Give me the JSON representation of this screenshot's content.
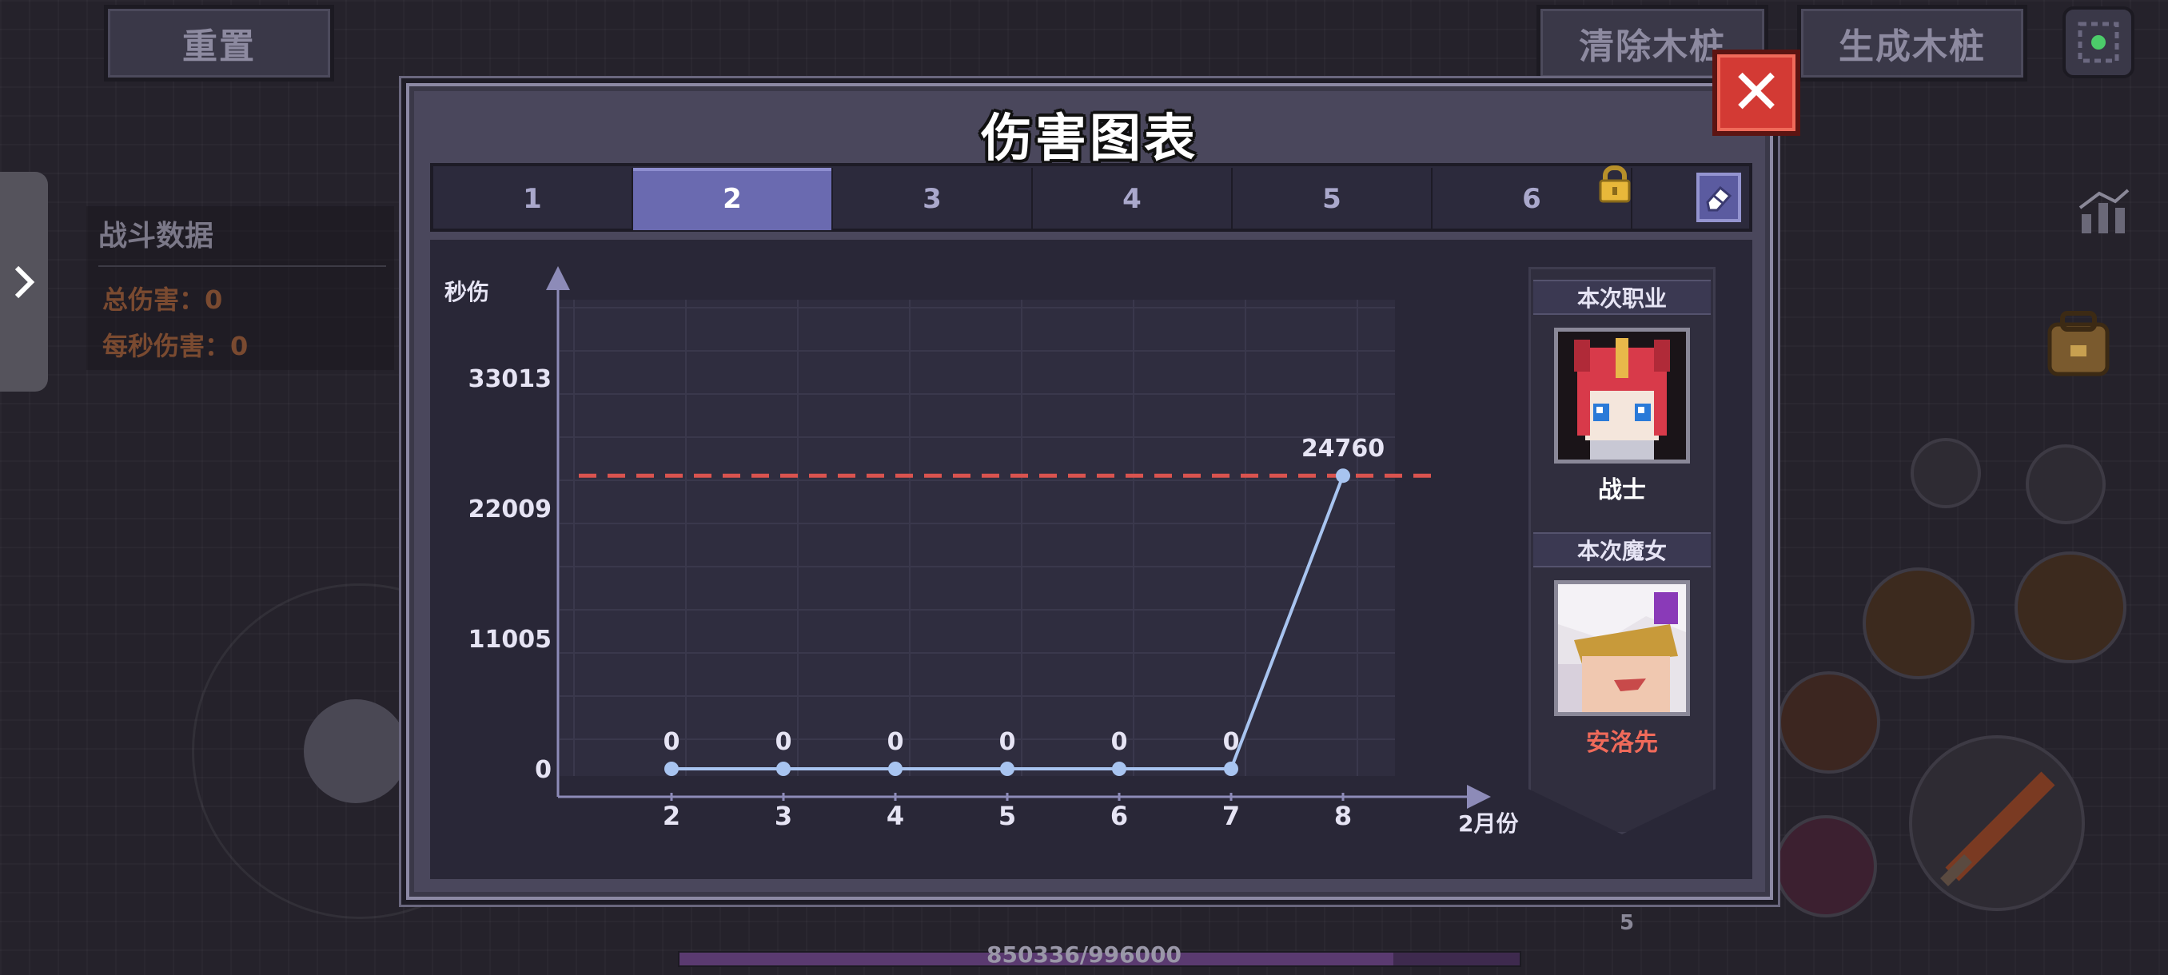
{
  "hud": {
    "reset_label": "重置",
    "clear_dummy_label": "清除木桩",
    "spawn_dummy_label": "生成木桩",
    "hp_text": "850336/996000",
    "skill_count": "5"
  },
  "stats_panel": {
    "title": "战斗数据",
    "total_damage": "总伤害：0",
    "dps": "每秒伤害：0"
  },
  "modal": {
    "title": "伤害图表",
    "tabs": [
      {
        "label": "1"
      },
      {
        "label": "2"
      },
      {
        "label": "3"
      },
      {
        "label": "4"
      },
      {
        "label": "5"
      },
      {
        "label": "6"
      }
    ],
    "active_tab": "2",
    "side": {
      "class_label": "本次职业",
      "class_name": "战士",
      "witch_label": "本次魔女",
      "witch_name": "安洛先"
    }
  },
  "colors": {
    "line": "#a8c4f0",
    "threshold": "#d9534f",
    "witch_name": "#f06a5a",
    "class_name": "#ffffff"
  },
  "chart_data": {
    "type": "line",
    "ylabel": "秒伤",
    "xlabel": "2月份",
    "x": [
      "2",
      "3",
      "4",
      "5",
      "6",
      "7",
      "8"
    ],
    "values": [
      0,
      0,
      0,
      0,
      0,
      0,
      24760
    ],
    "data_labels": [
      "0",
      "0",
      "0",
      "0",
      "0",
      "0",
      "24760"
    ],
    "y_ticks": [
      0,
      11005,
      22009,
      33013
    ],
    "y_tick_labels": [
      "0",
      "11005",
      "22009",
      "33013"
    ],
    "ylim": [
      0,
      36000
    ],
    "reference_line": 24760,
    "grid": true
  }
}
